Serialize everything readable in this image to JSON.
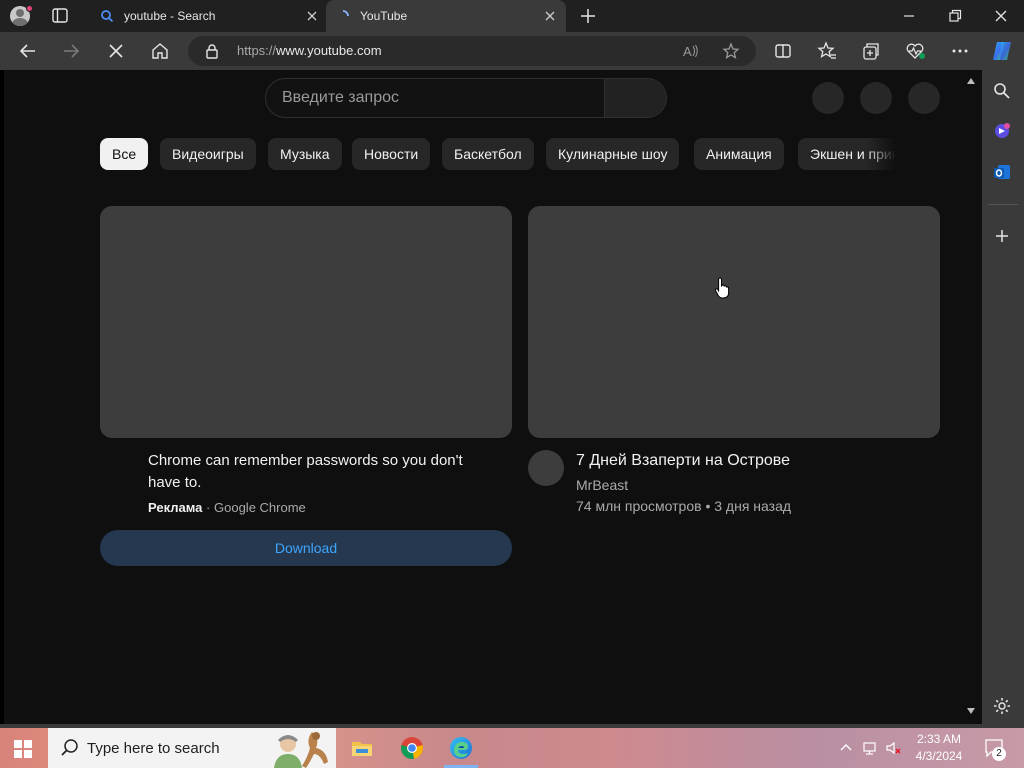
{
  "browser": {
    "tabs": [
      {
        "title": "youtube - Search",
        "favicon": "search-icon",
        "active": false
      },
      {
        "title": "YouTube",
        "favicon": "loading-icon",
        "active": true
      }
    ],
    "address": {
      "url_prefix": "https://",
      "url_host": "www.youtube.com"
    }
  },
  "youtube": {
    "search_placeholder": "Введите запрос",
    "chips": [
      "Все",
      "Видеоигры",
      "Музыка",
      "Новости",
      "Баскетбол",
      "Кулинарные шоу",
      "Анимация",
      "Экшен и приключения"
    ],
    "ad": {
      "title": "Chrome can remember passwords so you don't have to.",
      "label": "Реклама",
      "separator": "·",
      "advertiser": "Google Chrome",
      "cta": "Download"
    },
    "video": {
      "title": "7 Дней Взаперти на Острове",
      "channel": "MrBeast",
      "views": "74 млн просмотров",
      "separator": "•",
      "age": "3 дня назад"
    }
  },
  "taskbar": {
    "search_placeholder": "Type here to search",
    "time": "2:33 AM",
    "date": "4/3/2024",
    "notification_count": "2"
  },
  "colors": {
    "youtube_bg": "#0f0f0f",
    "chip_bg": "#272727",
    "chip_active_bg": "#f1f1f1",
    "link_blue": "#3ea6ff",
    "download_bg": "#263850",
    "browser_chrome": "#3a3a3a",
    "tabstrip": "#202020"
  }
}
